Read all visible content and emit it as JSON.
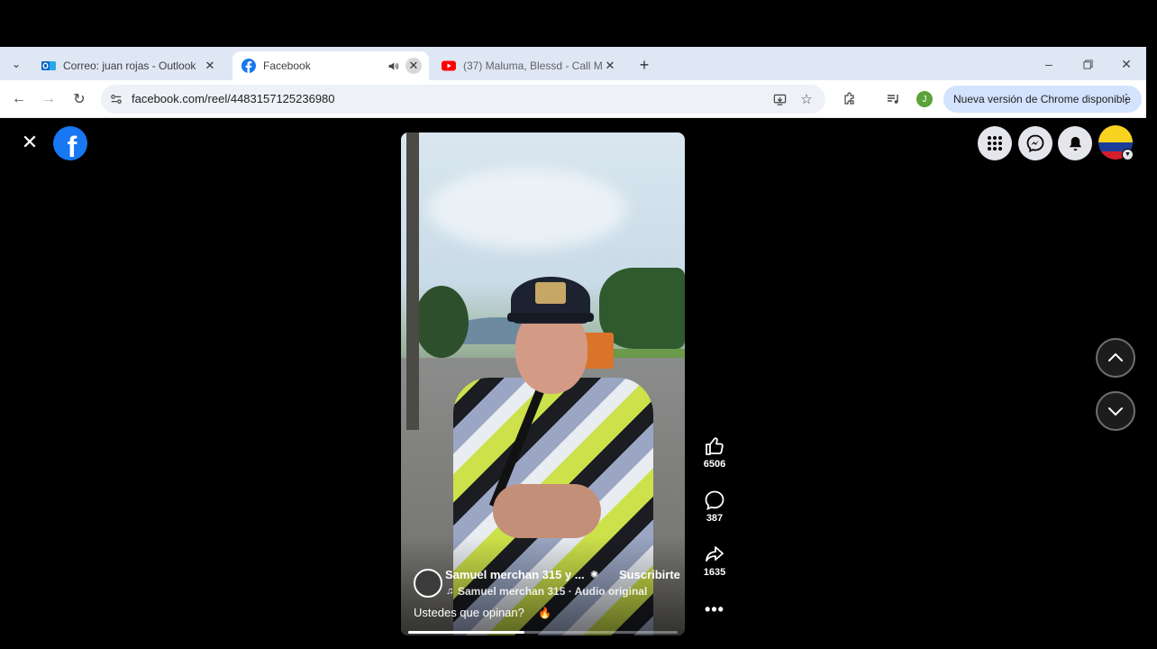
{
  "browser": {
    "tabs": [
      {
        "title": "Correo: juan rojas - Outlook",
        "active": false,
        "favicon": "outlook-icon"
      },
      {
        "title": "Facebook",
        "active": true,
        "favicon": "facebook-icon",
        "audio": true
      },
      {
        "title": "(37) Maluma, Blessd - Call Me (",
        "active": false,
        "favicon": "youtube-icon"
      }
    ],
    "url": "facebook.com/reel/4483157125236980",
    "profile_initial": "J",
    "update_label": "Nueva versión de Chrome disponible"
  },
  "reel": {
    "author": "Samuel merchan 315 y ...",
    "subscribe_label": "Suscribirte",
    "audio": "Samuel merchan 315 · Audio original",
    "caption": "Ustedes que opinan?",
    "caption_emoji": "🔥",
    "likes": "6506",
    "comments": "387",
    "shares": "1635",
    "progress": 0.43
  },
  "colors": {
    "facebook_blue": "#1877f2",
    "update_pill": "#d3e3fd",
    "tabstrip": "#dfe6f4"
  }
}
